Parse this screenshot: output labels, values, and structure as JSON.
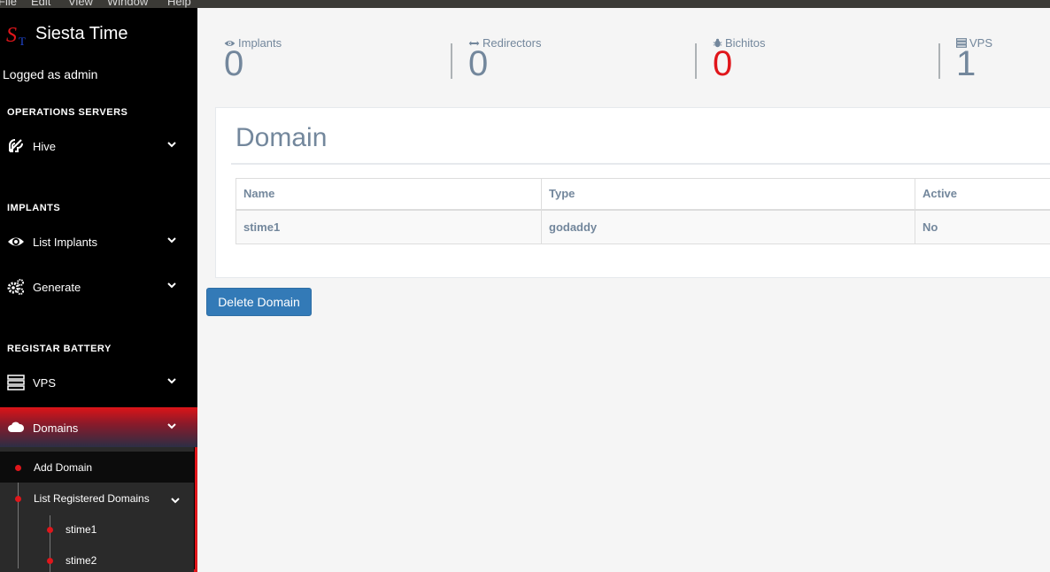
{
  "os_menu": [
    "File",
    "Edit",
    "View",
    "Window",
    "Help"
  ],
  "brand": {
    "logo_s": "S",
    "logo_t": "T",
    "title": "Siesta Time"
  },
  "user": {
    "logged_text": "Logged as admin"
  },
  "sidebar": {
    "sections": [
      {
        "title": "OPERATIONS SERVERS",
        "items": [
          {
            "label": "Hive",
            "icon": "hive-icon"
          }
        ]
      },
      {
        "title": "IMPLANTS",
        "items": [
          {
            "label": "List Implants",
            "icon": "eye-icon"
          },
          {
            "label": "Generate",
            "icon": "gears-icon"
          }
        ]
      },
      {
        "title": "REGISTAR BATTERY",
        "items": [
          {
            "label": "VPS",
            "icon": "server-icon"
          },
          {
            "label": "Domains",
            "icon": "cloud-icon",
            "active": true
          }
        ]
      }
    ],
    "submenu": {
      "add_domain": "Add Domain",
      "list_registered": "List Registered Domains",
      "domains": [
        "stime1",
        "stime2"
      ]
    }
  },
  "stats": [
    {
      "label": "Implants",
      "value": "0",
      "icon": "eye-icon"
    },
    {
      "label": "Redirectors",
      "value": "0",
      "icon": "arrows-h-icon"
    },
    {
      "label": "Bichitos",
      "value": "0",
      "icon": "bug-icon",
      "color": "#e0161b"
    },
    {
      "label": "VPS",
      "value": "1",
      "icon": "server-icon"
    }
  ],
  "panel": {
    "title": "Domain",
    "columns": [
      "Name",
      "Type",
      "Active"
    ],
    "rows": [
      [
        "stime1",
        "godaddy",
        "No"
      ]
    ]
  },
  "actions": {
    "delete_label": "Delete Domain"
  },
  "colors": {
    "accent": "#e0161b",
    "primary_button": "#337ab7",
    "muted_text": "#73879c"
  }
}
